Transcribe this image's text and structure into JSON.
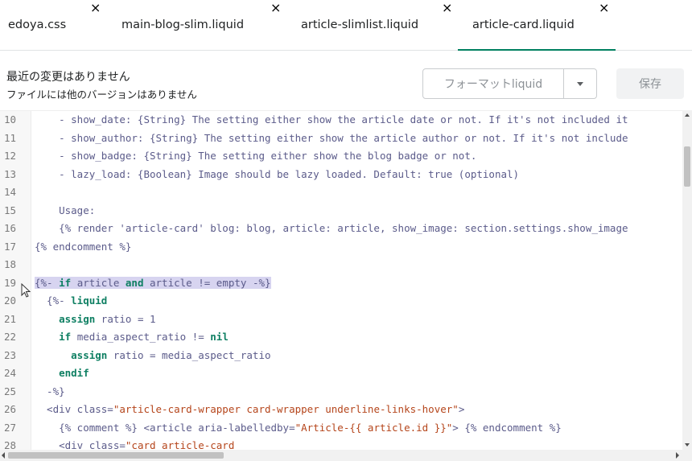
{
  "tabs": [
    {
      "label": "edoya.css",
      "close": "×"
    },
    {
      "label": "main-blog-slim.liquid",
      "close": "×"
    },
    {
      "label": "article-slimlist.liquid",
      "close": "×"
    },
    {
      "label": "article-card.liquid",
      "close": "×",
      "active": true
    }
  ],
  "toolbar": {
    "status_line1": "最近の変更はありません",
    "status_line2": "ファイルには他のバージョンはありません",
    "format_label": "フォーマットliquid",
    "save_label": "保存"
  },
  "editor": {
    "highlighted_line": 19,
    "lines": [
      {
        "n": "10",
        "text": "    - show_date: {String} The setting either show the article date or not. If it's not included it"
      },
      {
        "n": "11",
        "text": "    - show_author: {String} The setting either show the article author or not. If it's not include"
      },
      {
        "n": "12",
        "text": "    - show_badge: {String} The setting either show the blog badge or not."
      },
      {
        "n": "13",
        "text": "    - lazy_load: {Boolean} Image should be lazy loaded. Default: true (optional)"
      },
      {
        "n": "14",
        "text": ""
      },
      {
        "n": "15",
        "text": "    Usage:"
      },
      {
        "n": "16",
        "text": "    {% render 'article-card' blog: blog, article: article, show_image: section.settings.show_image"
      },
      {
        "n": "17",
        "text": "{% endcomment %}"
      },
      {
        "n": "18",
        "text": ""
      },
      {
        "n": "19",
        "text": "{%- if article and article != empty -%}"
      },
      {
        "n": "20",
        "text": "  {%- liquid"
      },
      {
        "n": "21",
        "text": "    assign ratio = 1"
      },
      {
        "n": "22",
        "text": "    if media_aspect_ratio != nil"
      },
      {
        "n": "23",
        "text": "      assign ratio = media_aspect_ratio"
      },
      {
        "n": "24",
        "text": "    endif"
      },
      {
        "n": "25",
        "text": "  -%}"
      },
      {
        "n": "26",
        "text": "  <div class=\"article-card-wrapper card-wrapper underline-links-hover\">"
      },
      {
        "n": "27",
        "text": "    {% comment %} <article aria-labelledby=\"Article-{{ article.id }}\"> {% endcomment %}"
      },
      {
        "n": "28",
        "text": "    <div class=\"card article-card"
      }
    ]
  },
  "colors": {
    "accent": "#008060",
    "highlight": "#d7d4f0",
    "keyword": "#0e7f62",
    "string": "#b5451b"
  }
}
